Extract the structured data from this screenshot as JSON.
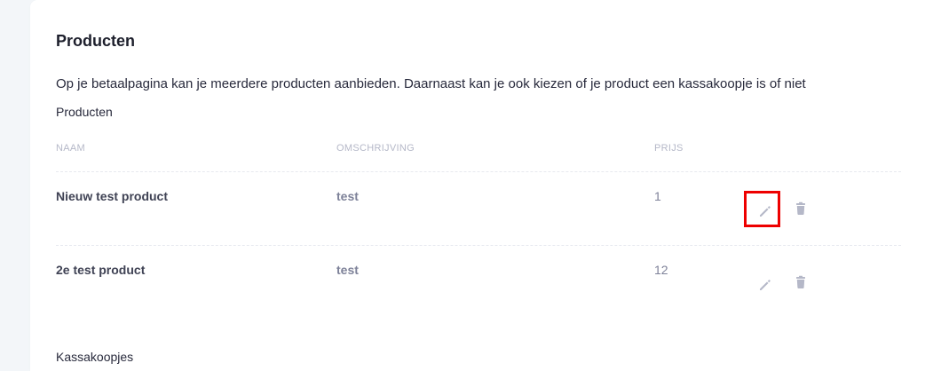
{
  "page": {
    "title": "Producten",
    "description": "Op je betaalpagina kan je meerdere producten aanbieden. Daarnaast kan je ook kiezen of je product een kassakoopje is of niet",
    "products_heading": "Producten",
    "kassakoopjes_heading": "Kassakoopjes"
  },
  "table": {
    "columns": [
      "NAAM",
      "OMSCHRIJVING",
      "PRIJS"
    ],
    "rows": [
      {
        "name": "Nieuw test product",
        "description": "test",
        "price": "1"
      },
      {
        "name": "2e test product",
        "description": "test",
        "price": "12"
      }
    ]
  },
  "icons": {
    "edit": "pencil-icon",
    "delete": "trash-icon"
  },
  "colors": {
    "highlight": "#ee0000",
    "icon": "#b5b8c8"
  }
}
